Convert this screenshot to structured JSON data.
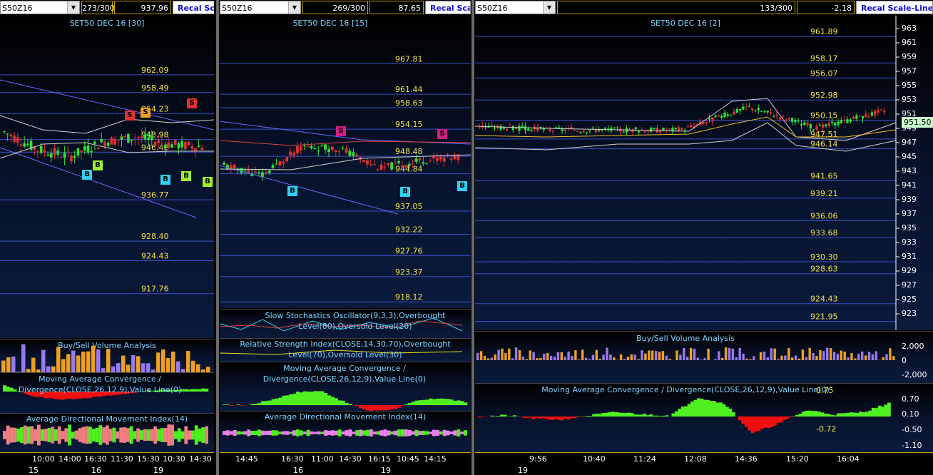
{
  "panes": [
    {
      "symbol": "S50Z16",
      "count": "273/300",
      "last": "937.96",
      "recal": "Recal Scale",
      "title": "SET50 DEC 16  [30]",
      "levels": [
        "962.09",
        "958.49",
        "954.23",
        "948.98",
        "946.42",
        "936.77",
        "928.40",
        "924.43",
        "917.76"
      ],
      "indicators": [
        "Buy/Sell Volume Analysis",
        "Moving Average Convergence / Divergence(CLOSE,26,12,9),Value Line(0)",
        "Average Directional Movement Index(14)"
      ],
      "time_ticks": [
        "10:00",
        "14:00",
        "16:30",
        "11:30",
        "15:30",
        "10:30",
        "14:30"
      ],
      "date_ticks": [
        "15",
        "16",
        "19"
      ],
      "markers": {
        "sell": "S",
        "buy": "B"
      }
    },
    {
      "symbol": "S50Z16",
      "count": "269/300",
      "last": "87.65",
      "recal": "Recal Scale",
      "title": "SET50 DEC 16  [15]",
      "levels": [
        "967.81",
        "961.44",
        "958.63",
        "954.15",
        "948.48",
        "944.84",
        "937.05",
        "932.22",
        "927.76",
        "923.37",
        "918.12"
      ],
      "indicators": [
        "Slow Stochastics Oscillator(9,3,3),Overbought Level(80),Oversold Level(20)",
        "Relative Strength Index(CLOSE,14,30,70),Overbought Level(70),Oversold Level(30)",
        "Moving Average Convergence / Divergence(CLOSE,26,12,9),Value Line(0)",
        "Average Directional Movement Index(14)"
      ],
      "time_ticks": [
        "14:45",
        "16:30",
        "11:00",
        "14:30",
        "16:15",
        "10:45",
        "14:15"
      ],
      "date_ticks": [
        "16",
        "19"
      ],
      "markers": {
        "sell": "S",
        "buy": "B"
      }
    },
    {
      "symbol": "S50Z16",
      "count": "133/300",
      "last": "-2.18",
      "recal": "Recal Scale-Linear",
      "title": "SET50 DEC 16  [2]",
      "levels": [
        "961.89",
        "958.17",
        "956.07",
        "952.98",
        "950.15",
        "947.51",
        "946.14",
        "941.65",
        "939.21",
        "936.06",
        "933.68",
        "930.30",
        "928.63",
        "924.43",
        "921.95"
      ],
      "y_ticks": [
        "963",
        "961",
        "959",
        "957",
        "955",
        "953",
        "951",
        "949",
        "947",
        "945",
        "943",
        "941",
        "939",
        "937",
        "935",
        "933",
        "931",
        "929",
        "927",
        "925",
        "923"
      ],
      "current_price": "951.50",
      "indicators": [
        "Buy/Sell Volume Analysis",
        "Moving Average Convergence / Divergence(CLOSE,26,12,9),Value Line(0)"
      ],
      "volume_ticks": [
        "2,000",
        "0",
        "-2,000"
      ],
      "macd_ticks": [
        "0.70",
        "0.10",
        "-0.50",
        "-1.10"
      ],
      "macd_labels": [
        "0.75",
        "-0.72"
      ],
      "time_ticks": [
        "9:56",
        "10:40",
        "11:24",
        "12:08",
        "14:36",
        "15:20",
        "16:04"
      ],
      "date_ticks": [
        "19"
      ]
    }
  ],
  "colors": {
    "level_text": "#f2e24a",
    "level_line": "#3a50c8",
    "up_candle": "#30e030",
    "down_candle": "#e03030",
    "title": "#7fd4ff",
    "recal_text": "#1010d0"
  },
  "chart_data": [
    {
      "type": "line",
      "title": "SET50 DEC 16  [30]",
      "x": [
        "10:00",
        "14:00",
        "16:30",
        "11:30",
        "15:30",
        "10:30",
        "14:30"
      ],
      "series": [
        {
          "values": [
            950.5,
            947.0,
            945.5,
            948.5,
            949.5,
            948.0,
            947.5
          ]
        }
      ],
      "price_levels": [
        962.09,
        958.49,
        954.23,
        948.98,
        946.42,
        936.77,
        928.4,
        924.43,
        917.76
      ],
      "xlabel": "",
      "ylabel": ""
    },
    {
      "type": "line",
      "title": "SET50 DEC 16  [15]",
      "x": [
        "14:45",
        "16:30",
        "11:00",
        "14:30",
        "16:15",
        "10:45",
        "14:15"
      ],
      "series": [
        {
          "values": [
            946.5,
            944.5,
            950.5,
            950.0,
            946.0,
            947.5,
            948.5
          ]
        }
      ],
      "price_levels": [
        967.81,
        961.44,
        958.63,
        954.15,
        948.48,
        944.84,
        937.05,
        932.22,
        927.76,
        923.37,
        918.12
      ],
      "xlabel": "",
      "ylabel": ""
    },
    {
      "type": "line",
      "title": "SET50 DEC 16  [2]",
      "x": [
        "9:56",
        "10:40",
        "11:24",
        "12:08",
        "14:36",
        "15:20",
        "16:04"
      ],
      "series": [
        {
          "values": [
            949.3,
            948.8,
            948.8,
            948.8,
            952.0,
            949.0,
            951.5
          ]
        }
      ],
      "ylim": [
        922,
        964
      ],
      "price_levels": [
        961.89,
        958.17,
        956.07,
        952.98,
        950.15,
        947.51,
        946.14,
        941.65,
        939.21,
        936.06,
        933.68,
        930.3,
        928.63,
        924.43,
        921.95
      ],
      "xlabel": "",
      "ylabel": ""
    }
  ]
}
